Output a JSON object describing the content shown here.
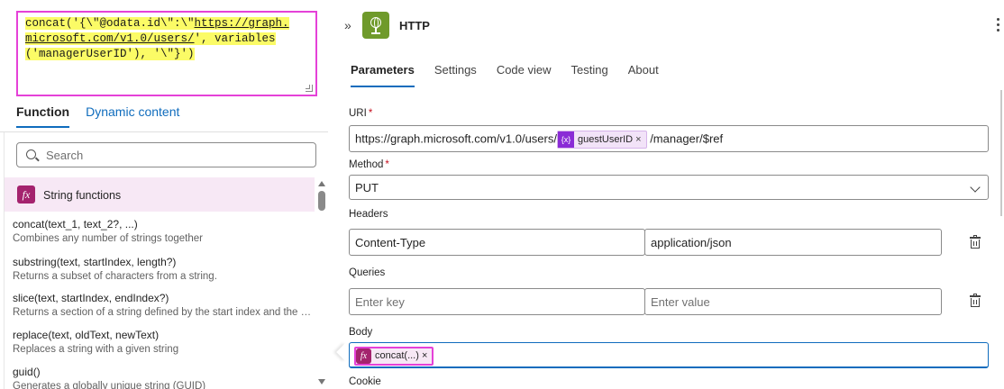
{
  "expression": {
    "lines": [
      {
        "pre": "concat('{\\\"@odata.id\\\":\\\"",
        "ul": "https://graph.",
        "post": ""
      },
      {
        "pre": "",
        "ul": "microsoft.com/v1.0/users/",
        "post": "', variables"
      },
      {
        "pre": "('managerUserID'), '\\\"}')",
        "ul": "",
        "post": ""
      }
    ]
  },
  "function_tabs": {
    "function": "Function",
    "dynamic": "Dynamic content"
  },
  "search": {
    "placeholder": "Search"
  },
  "category": {
    "icon": "fx-icon",
    "label": "String functions"
  },
  "functions": [
    {
      "name": "concat(text_1, text_2?, ...)",
      "desc": "Combines any number of strings together"
    },
    {
      "name": "substring(text, startIndex, length?)",
      "desc": "Returns a subset of characters from a string."
    },
    {
      "name": "slice(text, startIndex, endIndex?)",
      "desc": "Returns a section of a string defined by the start index and the end..."
    },
    {
      "name": "replace(text, oldText, newText)",
      "desc": "Replaces a string with a given string"
    },
    {
      "name": "guid()",
      "desc": "Generates a globally unique string (GUID)"
    }
  ],
  "action": {
    "title": "HTTP",
    "icon": "globe-icon",
    "color": "#6f9a2b",
    "tabs": [
      "Parameters",
      "Settings",
      "Code view",
      "Testing",
      "About"
    ]
  },
  "uri": {
    "label": "URI",
    "required": "*",
    "prefix": "https://graph.microsoft.com/v1.0/users/",
    "token_icon": "{x}",
    "token": "guestUserID",
    "token_x": "×",
    "suffix": "/manager/$ref"
  },
  "method": {
    "label": "Method",
    "required": "*",
    "value": "PUT"
  },
  "headers": {
    "label": "Headers",
    "key": "Content-Type",
    "value": "application/json"
  },
  "queries": {
    "label": "Queries",
    "key_placeholder": "Enter key",
    "value_placeholder": "Enter value"
  },
  "body": {
    "label": "Body",
    "token_icon": "fx",
    "token": "concat(...)",
    "token_x": "×"
  },
  "cookie": {
    "label": "Cookie"
  },
  "colors": {
    "accent": "#0f6cbd",
    "highlight": "#fbfb66",
    "focus_border": "#e541d8",
    "function_badge": "#a4236e"
  }
}
